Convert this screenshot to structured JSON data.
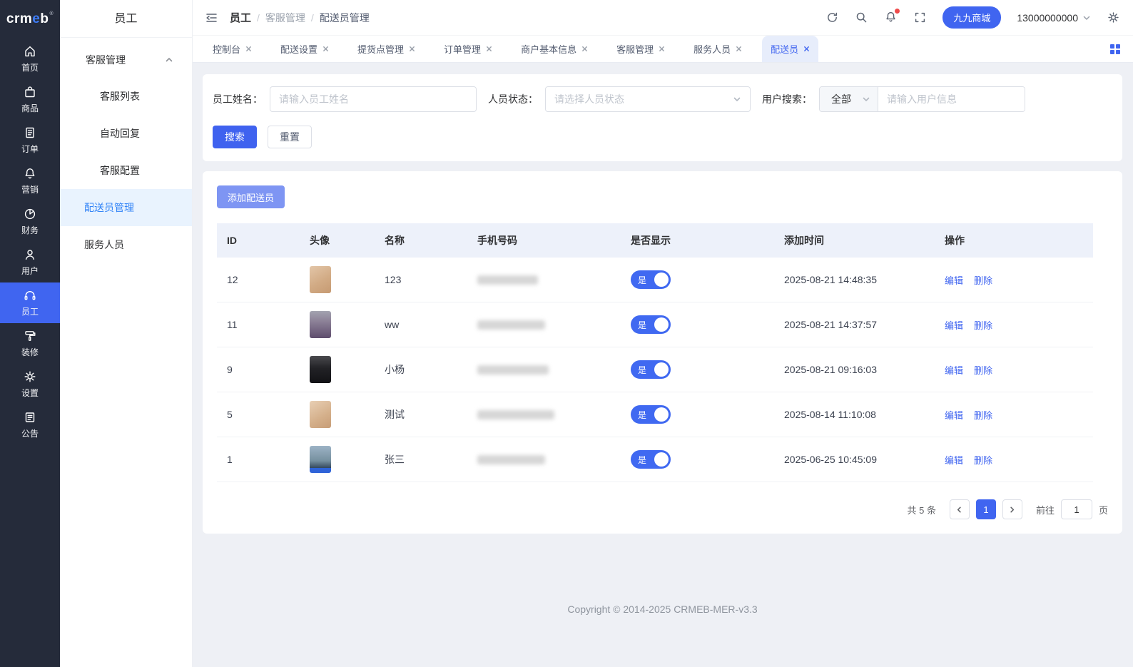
{
  "brand": {
    "prefix": "crm",
    "accent": "e",
    "suffix": "b",
    "registered": "®"
  },
  "primary_nav": {
    "items": [
      {
        "label": "首页",
        "icon": "home-icon"
      },
      {
        "label": "商品",
        "icon": "goods-icon"
      },
      {
        "label": "订单",
        "icon": "order-icon"
      },
      {
        "label": "营销",
        "icon": "marketing-icon"
      },
      {
        "label": "财务",
        "icon": "finance-icon"
      },
      {
        "label": "用户",
        "icon": "user-icon"
      },
      {
        "label": "员工",
        "icon": "staff-headset-icon",
        "active": true
      },
      {
        "label": "装修",
        "icon": "decorate-icon"
      },
      {
        "label": "设置",
        "icon": "settings-icon"
      },
      {
        "label": "公告",
        "icon": "notice-icon"
      }
    ]
  },
  "secondary_nav": {
    "title": "员工",
    "group_label": "客服管理",
    "children": [
      "客服列表",
      "自动回复",
      "客服配置"
    ],
    "root_items": [
      {
        "label": "配送员管理",
        "active": true
      },
      {
        "label": "服务人员"
      }
    ]
  },
  "topbar": {
    "breadcrumb": {
      "root": "员工",
      "separator": "/",
      "mid": "客服管理",
      "current": "配送员管理"
    },
    "merchant_badge": "九九商城",
    "account_phone": "13000000000"
  },
  "tabs": [
    {
      "label": "控制台"
    },
    {
      "label": "配送设置"
    },
    {
      "label": "提货点管理"
    },
    {
      "label": "订单管理"
    },
    {
      "label": "商户基本信息"
    },
    {
      "label": "客服管理"
    },
    {
      "label": "服务人员"
    },
    {
      "label": "配送员",
      "active": true
    }
  ],
  "filters": {
    "name_label": "员工姓名：",
    "name_placeholder": "请输入员工姓名",
    "status_label": "人员状态：",
    "status_placeholder": "请选择人员状态",
    "user_label": "用户搜索：",
    "user_scope_value": "全部",
    "user_placeholder": "请输入用户信息",
    "search_button": "搜索",
    "reset_button": "重置"
  },
  "toolbar": {
    "add_delivery_button": "添加配送员"
  },
  "table": {
    "columns": [
      "ID",
      "头像",
      "名称",
      "手机号码",
      "是否显示",
      "添加时间",
      "操作"
    ],
    "show_on_label": "是",
    "actions": {
      "edit": "编辑",
      "delete": "删除"
    },
    "rows": [
      {
        "id": "12",
        "name": "123",
        "time": "2025-08-21 14:48:35",
        "avatar_css": "background:linear-gradient(150deg,#e3c6a8 0%,#d2ab85 55%,#c69a72 100%)",
        "phone_css": "width:85px"
      },
      {
        "id": "11",
        "name": "ww",
        "time": "2025-08-21 14:37:57",
        "avatar_css": "background:linear-gradient(180deg,#a3a3b0 0%,#8b7f96 40%,#5e4d6d 100%)",
        "phone_css": "width:95px"
      },
      {
        "id": "9",
        "name": "小杨",
        "time": "2025-08-21 09:16:03",
        "avatar_css": "background:linear-gradient(180deg,#4a4a4e 0%,#222226 45%,#121215 100%)",
        "phone_css": "width:100px"
      },
      {
        "id": "5",
        "name": "测试",
        "time": "2025-08-14 11:10:08",
        "avatar_css": "background:linear-gradient(150deg,#e8cfb4 0%,#d4af8a 60%,#c79d77 100%)",
        "phone_css": "width:108px"
      },
      {
        "id": "1",
        "name": "张三",
        "time": "2025-06-25 10:45:09",
        "avatar_css": "background:linear-gradient(180deg,#9db3c6 0%,#76909f 55%,#33475c 82%,#2f63d8 82%,#2f63d8 100%)",
        "phone_css": "width:95px"
      }
    ]
  },
  "pagination": {
    "total_text": "共 5 条",
    "current_page": "1",
    "goto_label": "前往",
    "goto_value": "1",
    "page_unit": "页"
  },
  "footer": {
    "copyright": "Copyright © 2014-2025 CRMEB-MER-v3.3"
  },
  "colors": {
    "primary": "#4065f0",
    "primary_light": "#7e95f3",
    "sidebar_bg": "#252b3a",
    "submenu_active_bg": "#e9f3fe",
    "table_header_bg": "#edf1fa"
  }
}
